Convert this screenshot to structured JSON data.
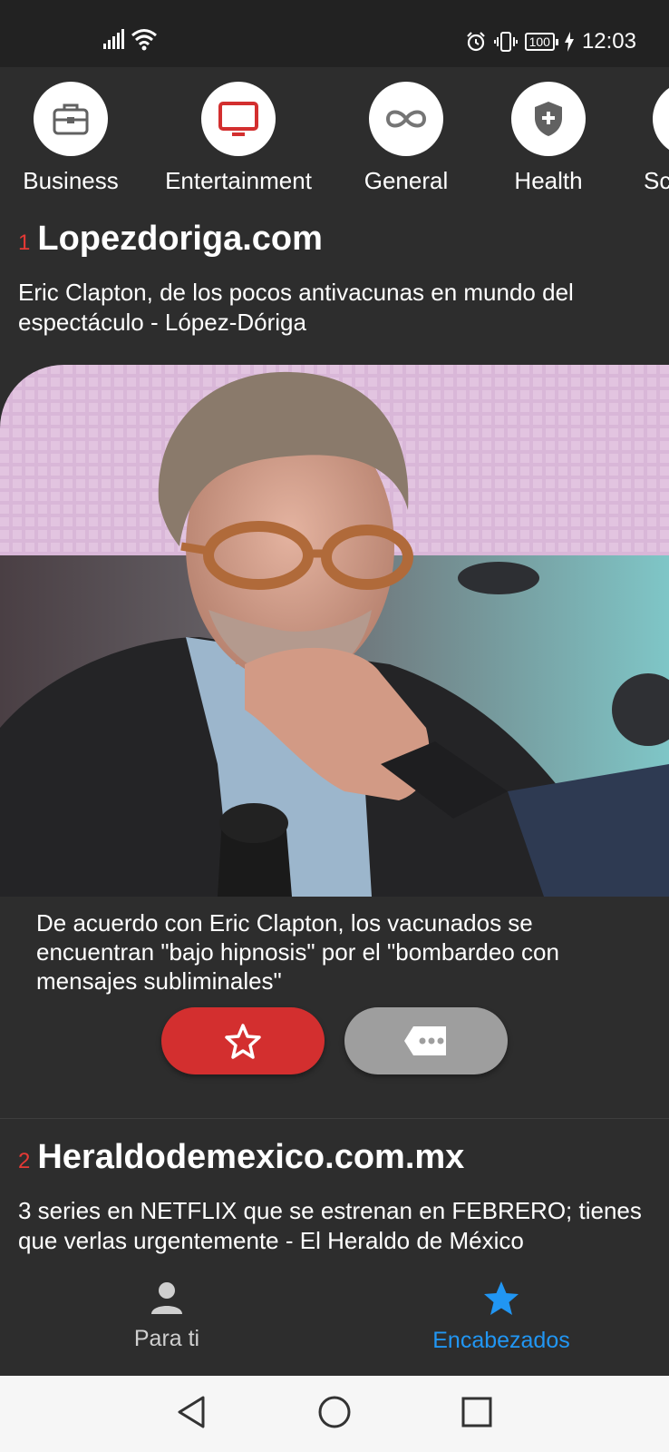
{
  "status_bar": {
    "time": "12:03",
    "battery": "100",
    "icons": [
      "signal-icon",
      "wifi-icon",
      "alarm-icon",
      "vibrate-icon",
      "battery-icon",
      "charging-icon"
    ]
  },
  "categories": [
    {
      "label": "Business",
      "icon": "briefcase-icon"
    },
    {
      "label": "Entertainment",
      "icon": "tv-icon"
    },
    {
      "label": "General",
      "icon": "infinity-icon"
    },
    {
      "label": "Health",
      "icon": "shield-plus-icon"
    },
    {
      "label": "Sc",
      "icon": "science-icon"
    }
  ],
  "articles": [
    {
      "rank": "1",
      "source": "Lopezdoriga.com",
      "headline": "Eric Clapton, de los pocos antivacunas en mundo del espectáculo - López-Dóriga",
      "description": "De acuerdo con Eric Clapton, los vacunados se encuentran \"bajo hipnosis\" por el \"bombardeo con mensajes subliminales\"",
      "favorite_icon": "star-outline-icon",
      "more_icon": "comment-dots-icon"
    },
    {
      "rank": "2",
      "source": "Heraldodemexico.com.mx",
      "headline": "3 series en NETFLIX que se estrenan en FEBRERO; tienes que verlas urgentemente - El Heraldo de México"
    }
  ],
  "bottom_nav": {
    "items": [
      {
        "label": "Para ti",
        "icon": "person-icon",
        "active": false
      },
      {
        "label": "Encabezados",
        "icon": "star-icon",
        "active": true
      }
    ],
    "active_color": "#2196f3"
  },
  "colors": {
    "accent_red": "#d32f2f",
    "rank_red": "#e53935",
    "background": "#2d2d2d"
  }
}
